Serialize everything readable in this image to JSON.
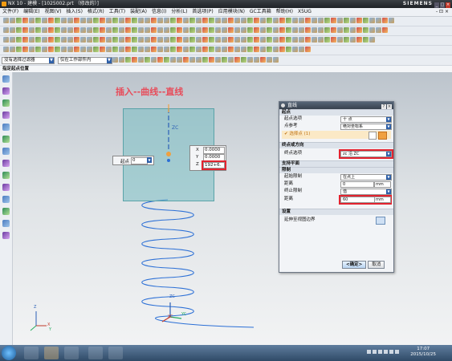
{
  "window": {
    "title": "NX 10 - 建模 - [1025002.prt （修改的）]",
    "brand": "SIEMENS",
    "controls": [
      "_",
      "□",
      "×"
    ]
  },
  "menu": {
    "items": [
      "文件(F)",
      "编辑(E)",
      "视图(V)",
      "插入(S)",
      "格式(R)",
      "工具(T)",
      "装配(A)",
      "信息(I)",
      "分析(L)",
      "首选项(P)",
      "应用模块(N)",
      "GC工具箱",
      "帮助(H)",
      "X5UG"
    ],
    "right": "- ⊡ ×"
  },
  "filterbar": {
    "selection_filter": "没有选择过滤器",
    "scope": "仅在工作部件内"
  },
  "subtitle": "指定起点位置",
  "annotation": "插入--曲线--直线",
  "canvas": {
    "zc_label": "ZC",
    "start_field_label": "起点",
    "start_field_value": "0",
    "x_label": "X",
    "x_value": "0.0000",
    "y_label": "Y",
    "y_value": "0.0000",
    "z_label": "Z",
    "z_value": "192+6.",
    "triad_zc": "ZC",
    "triad_xc": "XC",
    "triad_yc": "YC",
    "corner_z": "Z",
    "corner_x": "X",
    "corner_y": "Y"
  },
  "dialog": {
    "title": "直线",
    "title_buttons": [
      "?",
      "×"
    ],
    "sections": {
      "start": "起点",
      "end": "终点或方向",
      "support": "支持平面",
      "limits": "限制",
      "settings": "设置"
    },
    "rows": {
      "start_option_label": "起点选项",
      "start_option_value": "十 点",
      "point_ref_label": "点参考",
      "point_ref_value": "绝对坐标系",
      "select_point_label": "✔ 选择点 (1)",
      "end_option_label": "终点选项",
      "end_option_value": "zc 沿 ZC",
      "start_limit_label": "起始限制",
      "start_limit_value": "在点上",
      "distance1_label": "距离",
      "distance1_value": "0",
      "distance1_unit": "mm",
      "end_limit_label": "终止限制",
      "end_limit_value": "值",
      "distance2_label": "距离",
      "distance2_value": "60",
      "distance2_unit": "mm",
      "settings_label": "延伸至视图边界"
    },
    "ok": "<确定>",
    "cancel": "取消"
  },
  "taskbar": {
    "time": "17:07",
    "date": "2015/10/25"
  },
  "colors": {
    "annotation": "#e74c5a",
    "highlight": "#e3232f",
    "helix": "#2b6fd6",
    "plane": "#78bec3"
  }
}
